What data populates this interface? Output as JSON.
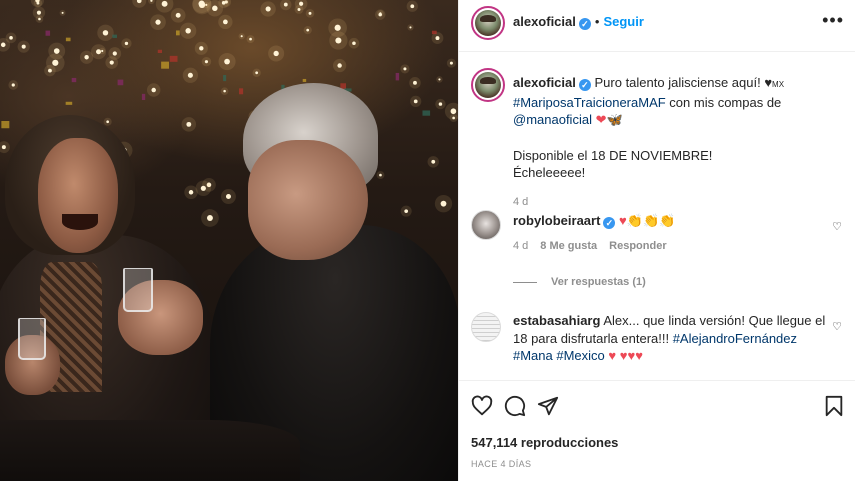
{
  "post": {
    "username": "alexoficial",
    "follow_label": "Seguir",
    "separator": "•",
    "more_label": "•••"
  },
  "caption": {
    "username": "alexoficial",
    "text": "Puro talento jalisciense aquí! ♥",
    "flag": "MX",
    "hashtag": "#MariposaTraicioneraMAF",
    "mid_text": " con mis compas de ",
    "mention": "@manaoficial",
    "emojis_red": "❤",
    "emojis_orange": "🦋",
    "line2": "Disponible el 18 DE NOVIEMBRE!",
    "line3": "Écheleeeee!",
    "time": "4 d"
  },
  "comments": [
    {
      "username": "robylobeiraart",
      "hearts": "♥",
      "hands": "👏👏👏",
      "time": "4 d",
      "likes": "8 Me gusta",
      "reply": "Responder",
      "view_replies": "Ver respuestas (1)"
    },
    {
      "username": "estabasahiarg",
      "text": "Alex... que linda versión! Que llegue el 18 para disfrutarla entera!!! ",
      "tag1": "#AlejandroFernández",
      "tag2": "#Mana",
      "tag3": "#Mexico",
      "hearts": "♥ ♥♥♥"
    }
  ],
  "stats": {
    "views": "547,114 reproducciones",
    "posted": "HACE 4 DÍAS"
  },
  "icons": [
    "heart-icon",
    "comment-icon",
    "share-icon",
    "bookmark-icon"
  ],
  "colors": {
    "verified": "#3897f0",
    "link": "#00376b",
    "follow": "#0095f6",
    "heart": "#ed4956"
  }
}
